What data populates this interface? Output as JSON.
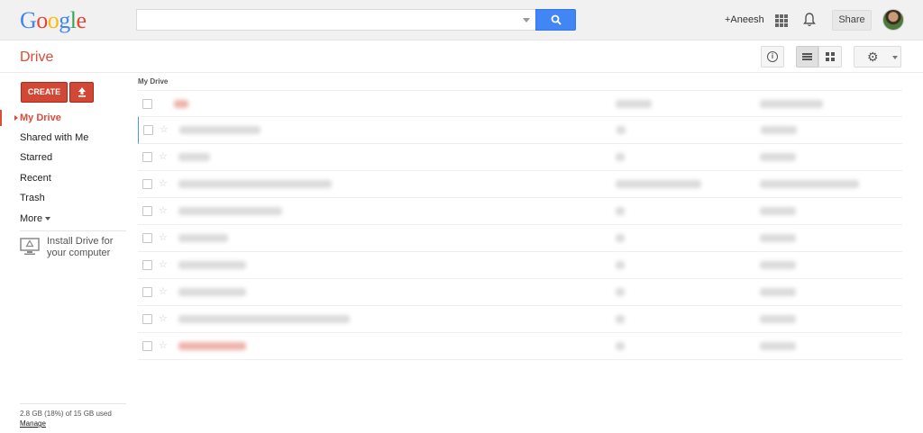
{
  "brand": {
    "logo_letters": [
      {
        "ch": "G",
        "color": "#4285f4"
      },
      {
        "ch": "o",
        "color": "#ea4335"
      },
      {
        "ch": "o",
        "color": "#fbbc05"
      },
      {
        "ch": "g",
        "color": "#4285f4"
      },
      {
        "ch": "l",
        "color": "#34a853"
      },
      {
        "ch": "e",
        "color": "#ea4335"
      }
    ]
  },
  "header": {
    "search": {
      "value": "",
      "placeholder": ""
    },
    "account_name": "+Aneesh",
    "share_label": "Share"
  },
  "subbar": {
    "title": "Drive",
    "info_icon": "i",
    "gear_icon": "⚙"
  },
  "sidebar": {
    "create_label": "CREATE",
    "nav": [
      {
        "label": "My Drive",
        "active": true
      },
      {
        "label": "Shared with Me",
        "active": false
      },
      {
        "label": "Starred",
        "active": false
      },
      {
        "label": "Recent",
        "active": false
      },
      {
        "label": "Trash",
        "active": false
      },
      {
        "label": "More",
        "active": false
      }
    ],
    "install_text": "Install Drive for your computer",
    "storage_text": "2.8 GB (18%) of 15 GB used",
    "manage_label": "Manage"
  },
  "main": {
    "breadcrumb": "My Drive",
    "star_glyph": "☆",
    "rows_count": 10
  },
  "colors": {
    "accent_red": "#dd4b39",
    "search_blue": "#4285f4",
    "selection_blue": "#4d90fe"
  }
}
